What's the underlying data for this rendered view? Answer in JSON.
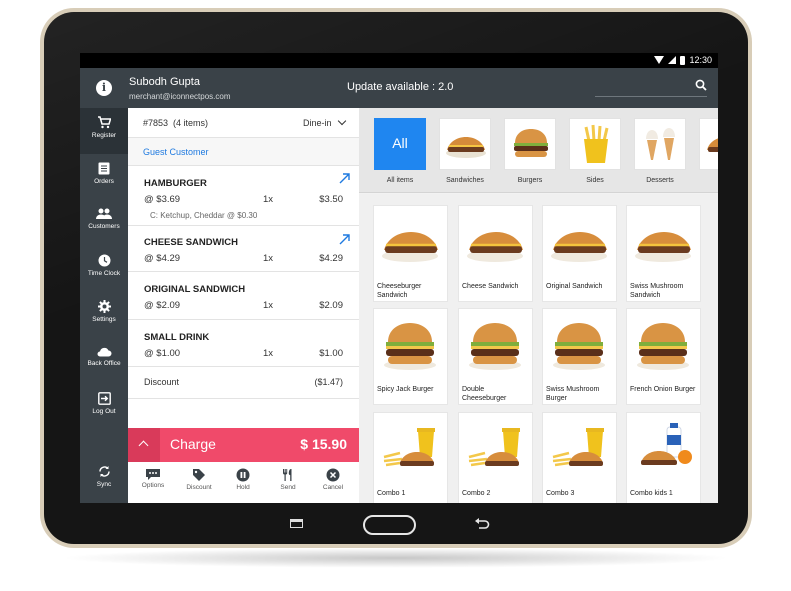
{
  "status_bar": {
    "time": "12:30"
  },
  "header": {
    "user_name": "Subodh Gupta",
    "user_email": "merchant@iconnectpos.com",
    "update_text": "Update available : 2.0"
  },
  "nav": [
    {
      "label": "Register",
      "icon": "cart-icon"
    },
    {
      "label": "Orders",
      "icon": "orders-icon"
    },
    {
      "label": "Customers",
      "icon": "customers-icon"
    },
    {
      "label": "Time Clock",
      "icon": "clock-icon"
    },
    {
      "label": "Settings",
      "icon": "gear-icon"
    },
    {
      "label": "Back Office",
      "icon": "cloud-icon"
    },
    {
      "label": "Log Out",
      "icon": "logout-icon"
    },
    {
      "label": "Sync",
      "icon": "sync-icon"
    }
  ],
  "cart": {
    "order_number": "#7853",
    "item_count": "(4 items)",
    "order_type": "Dine-in",
    "customer": "Guest Customer",
    "items": [
      {
        "name": "HAMBURGER",
        "price": "@ $3.69",
        "qty": "1x",
        "total": "$3.50",
        "modifiers": "C: Ketchup, Cheddar @ $0.30"
      },
      {
        "name": "CHEESE SANDWICH",
        "price": "@ $4.29",
        "qty": "1x",
        "total": "$4.29",
        "modifiers": ""
      },
      {
        "name": "ORIGINAL SANDWICH",
        "price": "@ $2.09",
        "qty": "1x",
        "total": "$2.09",
        "modifiers": ""
      },
      {
        "name": "SMALL DRINK",
        "price": "@ $1.00",
        "qty": "1x",
        "total": "$1.00",
        "modifiers": ""
      }
    ],
    "discount_label": "Discount",
    "discount_value": "($1.47)",
    "charge_label": "Charge",
    "charge_total": "$ 15.90",
    "actions": [
      {
        "label": "Options",
        "icon": "options-icon"
      },
      {
        "label": "Discount",
        "icon": "tag-icon"
      },
      {
        "label": "Hold",
        "icon": "pause-icon"
      },
      {
        "label": "Send",
        "icon": "fork-knife-icon"
      },
      {
        "label": "Cancel",
        "icon": "cancel-icon"
      }
    ]
  },
  "categories": [
    {
      "label": "All items",
      "tile_text": "All"
    },
    {
      "label": "Sandwiches"
    },
    {
      "label": "Burgers"
    },
    {
      "label": "Sides"
    },
    {
      "label": "Desserts"
    }
  ],
  "products": [
    {
      "name": "Cheeseburger Sandwich"
    },
    {
      "name": "Cheese Sandwich"
    },
    {
      "name": "Original Sandwich"
    },
    {
      "name": "Swiss Mushroom Sandwich"
    },
    {
      "name": "Spicy Jack Burger"
    },
    {
      "name": "Double Cheeseburger"
    },
    {
      "name": "Swiss Mushroom Burger"
    },
    {
      "name": "French Onion Burger"
    },
    {
      "name": "Combo 1"
    },
    {
      "name": "Combo 2"
    },
    {
      "name": "Combo 3"
    },
    {
      "name": "Combo kids 1"
    }
  ],
  "colors": {
    "header": "#3a4248",
    "accent_blue": "#1f86f0",
    "charge_pink": "#f04a6a"
  }
}
